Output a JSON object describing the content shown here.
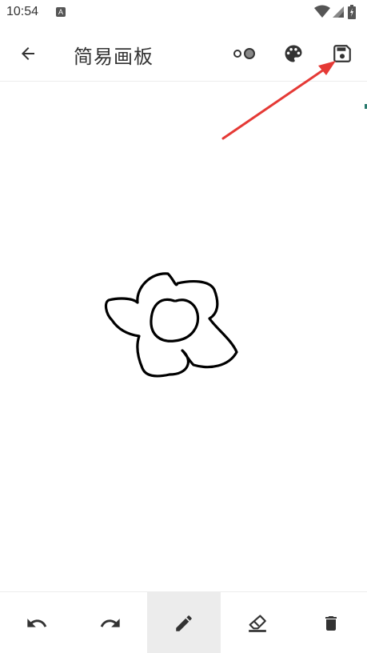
{
  "status_bar": {
    "time": "10:54",
    "notification_glyph": "A",
    "icons": [
      "wifi-icon",
      "signal-icon",
      "battery-icon"
    ]
  },
  "toolbar": {
    "title": "简易画板",
    "icons": [
      "back-arrow-icon",
      "stroke-size-icon",
      "palette-icon",
      "save-icon"
    ]
  },
  "bottom_bar": {
    "tools": [
      "undo-icon",
      "redo-icon",
      "pen-icon",
      "eraser-icon",
      "trash-icon"
    ],
    "selected_tool": "pen-icon"
  },
  "annotation": {
    "type": "red-arrow-pointing-to-save",
    "color": "#e53935"
  },
  "colors": {
    "icon": "#333333",
    "selected_tool_bg": "#ececec",
    "stroke": "#000000"
  }
}
